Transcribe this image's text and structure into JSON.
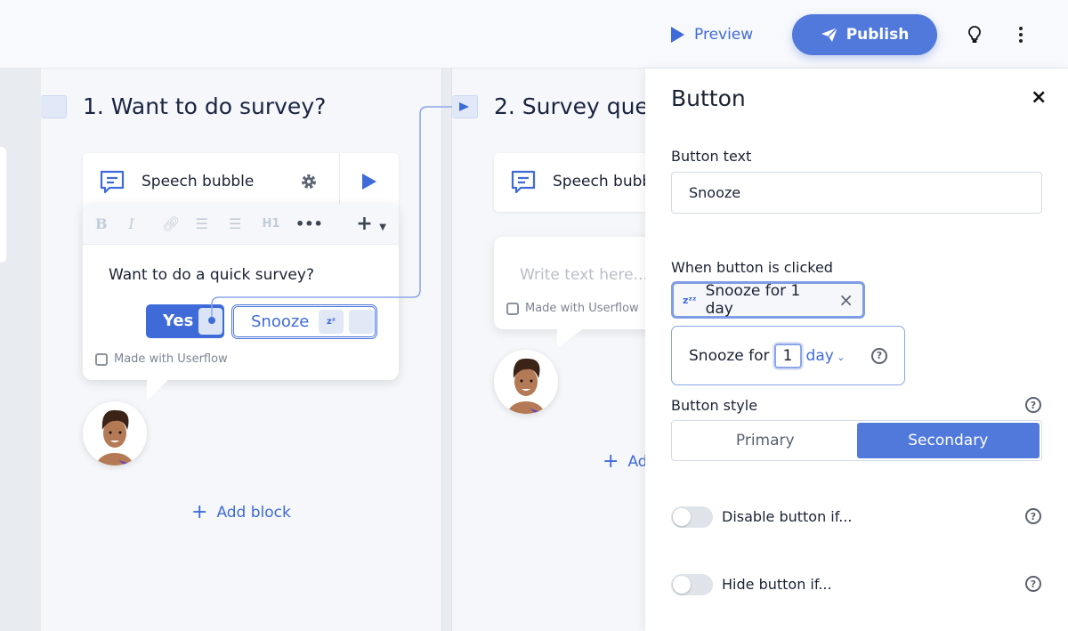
{
  "topbar": {
    "preview_label": "Preview",
    "publish_label": "Publish",
    "icons": [
      "play-icon",
      "paper-plane-icon",
      "lightbulb-icon",
      "more-vertical-icon"
    ]
  },
  "accent_color": "#5079db",
  "steps": [
    {
      "title": "1. Want to do survey?",
      "block_label": "Speech bubble",
      "toolbar": [
        "B",
        "I",
        "link",
        "ordered-list",
        "bullet-list",
        "H1",
        "•••",
        "+"
      ],
      "body_text": "Want to do a quick survey?",
      "buttons": [
        "Yes",
        "Snooze"
      ],
      "branding": "Made with Userflow",
      "add_block": "Add block"
    },
    {
      "title": "2. Survey que",
      "block_label": "Speech bubb",
      "placeholder": "Write text here...",
      "branding": "Made with Userflow",
      "add_block": "Ad"
    }
  ],
  "panel": {
    "title": "Button",
    "button_text_label": "Button text",
    "button_text_value": "Snooze",
    "when_clicked_label": "When button is clicked",
    "action_chip": "Snooze for 1 day",
    "popover": {
      "prefix": "Snooze for",
      "amount": "1",
      "unit": "day"
    },
    "style_label": "Button style",
    "style_options": [
      "Primary",
      "Secondary"
    ],
    "style_selected": "Secondary",
    "disable_label": "Disable button if...",
    "disable_on": false,
    "hide_label": "Hide button if...",
    "hide_on": false
  }
}
